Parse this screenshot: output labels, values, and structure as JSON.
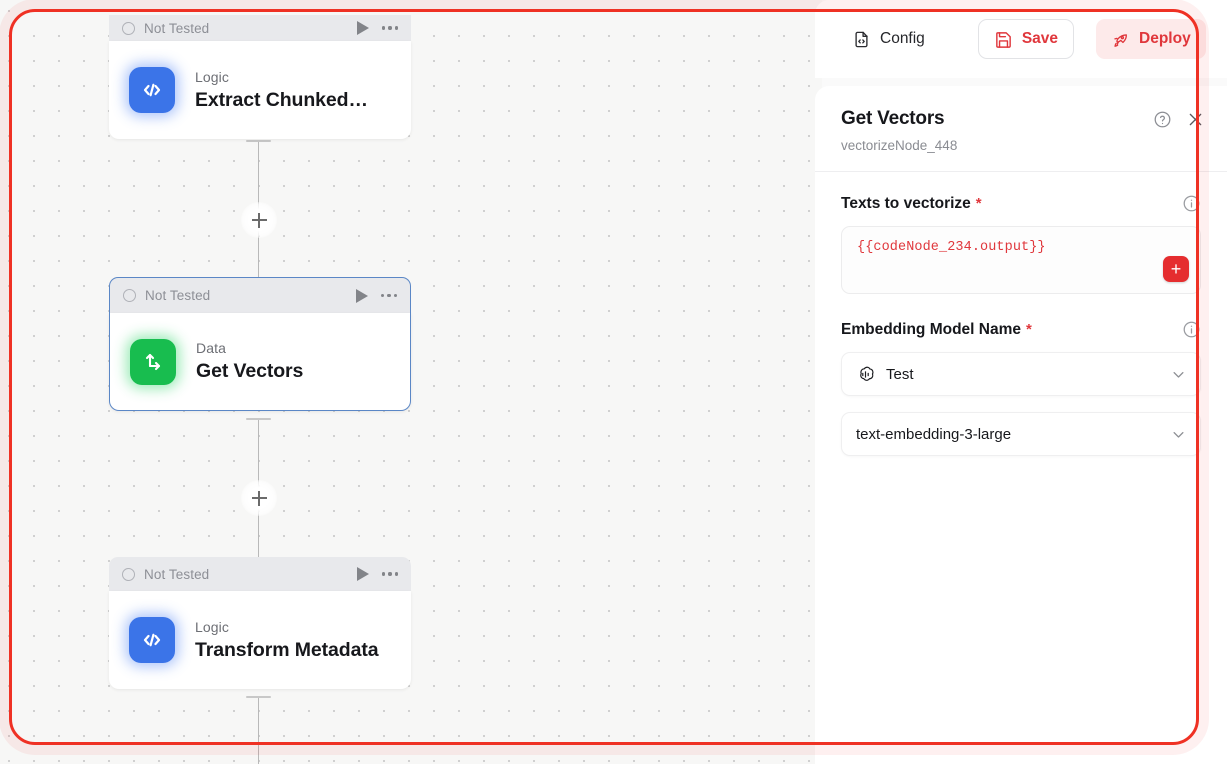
{
  "toolbar": {
    "config_label": "Config",
    "config_icon": "file-code-icon",
    "save_label": "Save",
    "save_icon": "floppy-disk-icon",
    "deploy_label": "Deploy",
    "deploy_icon": "rocket-icon",
    "accent_color": "#e0373c",
    "deploy_bg": "#fdeaea"
  },
  "panel": {
    "title": "Get Vectors",
    "subtitle": "vectorizeNode_448",
    "help_icon": "question-circle-icon",
    "close_icon": "close-icon",
    "fields": [
      {
        "label": "Texts to vectorize",
        "required_marker": "*",
        "info_icon": "info-circle-icon",
        "value": "{{codeNode_234.output}}",
        "add_button_label": "+"
      },
      {
        "label": "Embedding Model Name",
        "required_marker": "*",
        "info_icon": "info-circle-icon",
        "provider_value": "Test",
        "provider_icon": "openai-icon",
        "model_value": "text-embedding-3-large",
        "chevron_icon": "chevron-down-icon"
      }
    ]
  },
  "canvas": {
    "status_label": "Not Tested",
    "play_icon": "play-icon",
    "more_icon": "ellipsis-icon",
    "status_circle_icon": "circle-icon",
    "add_edge_icon": "plus-icon",
    "nodes": [
      {
        "kind": "Logic",
        "title": "Extract Chunked…",
        "icon": "code-brackets-icon",
        "icon_color": "#3b74e8",
        "status": "Not Tested",
        "selected": false
      },
      {
        "kind": "Data",
        "title": "Get Vectors",
        "icon": "data-transform-icon",
        "icon_color": "#18bd4f",
        "status": "Not Tested",
        "selected": true
      },
      {
        "kind": "Logic",
        "title": "Transform Metadata",
        "icon": "code-brackets-icon",
        "icon_color": "#3b74e8",
        "status": "Not Tested",
        "selected": false
      }
    ]
  },
  "highlight": {
    "color": "#ef3124"
  }
}
